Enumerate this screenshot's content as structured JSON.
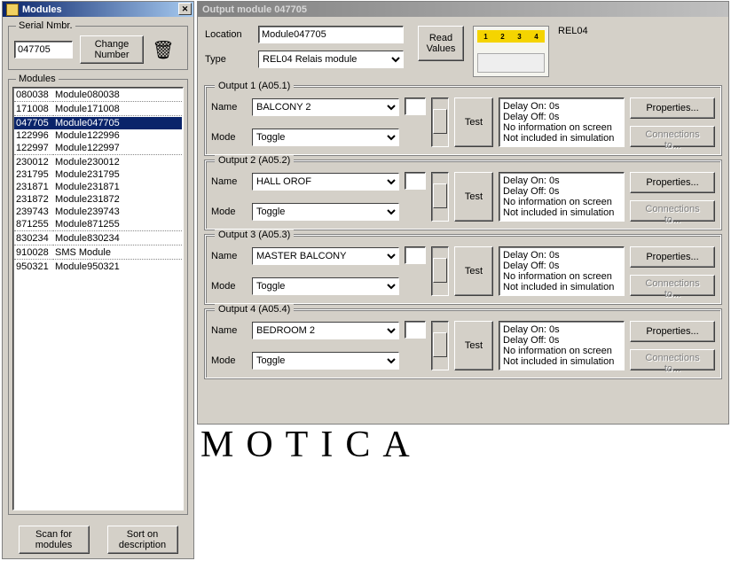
{
  "left": {
    "title": "Modules",
    "close_glyph": "✕",
    "serial_group": "Serial Nmbr.",
    "serial_value": "047705",
    "change_number": "Change\nNumber",
    "trash_glyph": "🗑",
    "modules_group": "Modules",
    "rows": [
      {
        "sn": "080038",
        "name": "Module080038"
      },
      {
        "sep": true
      },
      {
        "sn": "171008",
        "name": "Module171008"
      },
      {
        "sep": true
      },
      {
        "sn": "047705",
        "name": "Module047705",
        "selected": true
      },
      {
        "sn": "122996",
        "name": "Module122996"
      },
      {
        "sn": "122997",
        "name": "Module122997"
      },
      {
        "sep": true
      },
      {
        "sn": "230012",
        "name": "Module230012"
      },
      {
        "sn": "231795",
        "name": "Module231795"
      },
      {
        "sn": "231871",
        "name": "Module231871"
      },
      {
        "sn": "231872",
        "name": "Module231872"
      },
      {
        "sn": "239743",
        "name": "Module239743"
      },
      {
        "sn": "871255",
        "name": "Module871255"
      },
      {
        "sep": true
      },
      {
        "sn": "830234",
        "name": "Module830234"
      },
      {
        "sep": true
      },
      {
        "sn": "910028",
        "name": "SMS Module"
      },
      {
        "sep": true
      },
      {
        "sn": "950321",
        "name": "Module950321"
      }
    ],
    "scan": "Scan for\nmodules",
    "sort": "Sort on\ndescription"
  },
  "right": {
    "title": "Output module 047705",
    "location_label": "Location",
    "location_value": "Module047705",
    "type_label": "Type",
    "type_value": "REL04 Relais module",
    "read_values": "Read\nValues",
    "device_code": "REL04",
    "strip_labels": [
      "1",
      "2",
      "3",
      "4"
    ],
    "properties": "Properties...",
    "connections": "Connections to...",
    "name_label": "Name",
    "mode_label": "Mode",
    "test": "Test",
    "outputs": [
      {
        "legend": "Output 1 (A05.1)",
        "name": "BALCONY 2",
        "mode": "Toggle",
        "info": "Delay On: 0s\nDelay Off: 0s\nNo information on screen\nNot included in simulation"
      },
      {
        "legend": "Output 2 (A05.2)",
        "name": "HALL OROF",
        "mode": "Toggle",
        "info": "Delay On: 0s\nDelay Off: 0s\nNo information on screen\nNot included in simulation"
      },
      {
        "legend": "Output 3 (A05.3)",
        "name": "MASTER BALCONY",
        "mode": "Toggle",
        "info": "Delay On: 0s\nDelay Off: 0s\nNo information on screen\nNot included in simulation"
      },
      {
        "legend": "Output 4 (A05.4)",
        "name": "BEDROOM 2",
        "mode": "Toggle",
        "info": "Delay On: 0s\nDelay Off: 0s\nNo information on screen\nNot included in simulation"
      }
    ]
  },
  "watermark": "MOTICA"
}
